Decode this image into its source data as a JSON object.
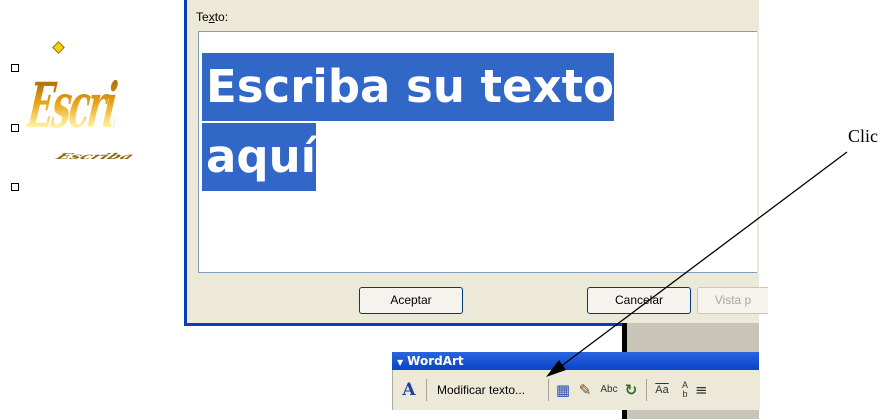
{
  "wordart_preview": {
    "text": "Escriba s",
    "shadow_text": "Escriba"
  },
  "dialog": {
    "field_label": "Texto:",
    "field_label_accel": "x",
    "text_lines": [
      "Escriba su texto",
      "aquí"
    ],
    "buttons": {
      "ok": "Aceptar",
      "cancel": "Cancelar",
      "preview": "Vista p"
    }
  },
  "toolbar": {
    "title": "WordArt",
    "edit_text_button": "Modificar texto...",
    "icons": [
      "insert-wordart-icon",
      "wordart-gallery-icon",
      "format-wordart-icon",
      "wordart-shape-icon",
      "free-rotate-icon",
      "same-letter-heights-icon",
      "vertical-text-icon",
      "alignment-icon"
    ]
  },
  "annotation": {
    "label": "Clic"
  },
  "colors": {
    "selection": "#3167c6",
    "dialog_frame": "#0a3fb8",
    "dialog_bg": "#ece9d8",
    "toolbar_title": "#0a44c8"
  }
}
